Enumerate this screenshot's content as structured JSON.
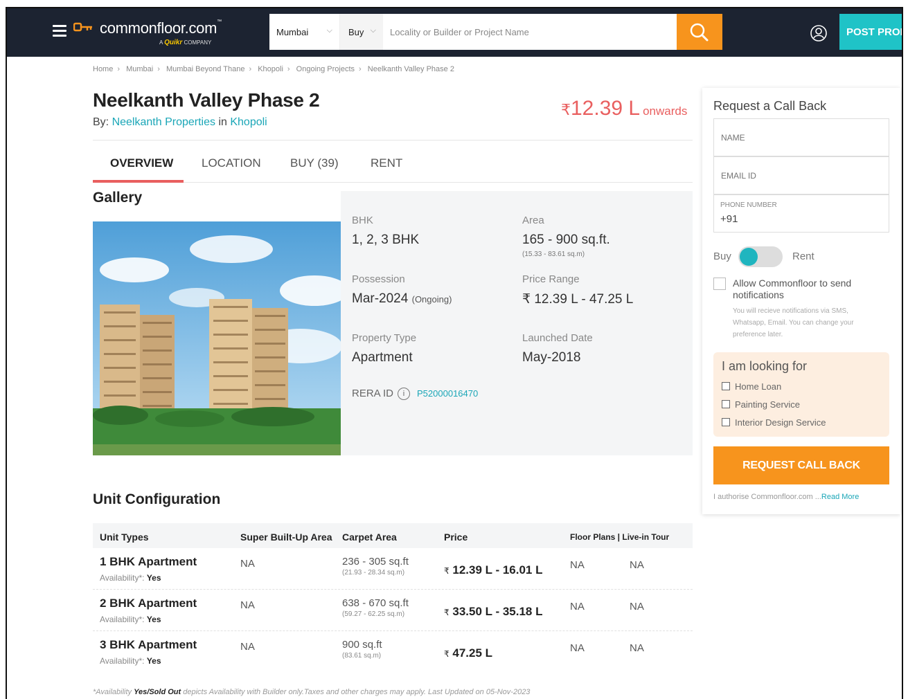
{
  "header": {
    "logo_text": "commonfloor.com",
    "logo_tm": "™",
    "logo_sub_a": "A",
    "logo_sub_quikr": "Quikr",
    "logo_sub_company": "COMPANY",
    "city": "Mumbai",
    "mode": "Buy",
    "search_placeholder": "Locality or Builder or Project Name",
    "post_label": "POST PROP"
  },
  "breadcrumb": [
    "Home",
    "Mumbai",
    "Mumbai Beyond Thane",
    "Khopoli",
    "Ongoing Projects",
    "Neelkanth Valley Phase 2"
  ],
  "project": {
    "title": "Neelkanth Valley Phase 2",
    "by_prefix": "By:",
    "builder": "Neelkanth Properties",
    "in_word": "in",
    "locality": "Khopoli",
    "price_symbol": "₹",
    "price": "12.39 L",
    "price_suffix": "onwards"
  },
  "tabs": [
    "OVERVIEW",
    "LOCATION",
    "BUY (39)",
    "RENT"
  ],
  "gallery_heading": "Gallery",
  "details": {
    "bhk_label": "BHK",
    "bhk_value": "1, 2, 3 BHK",
    "area_label": "Area",
    "area_value": "165 - 900 sq.ft.",
    "area_sub": "(15.33 - 83.61 sq.m)",
    "possession_label": "Possession",
    "possession_value": "Mar-2024",
    "possession_status": "(Ongoing)",
    "price_range_label": "Price Range",
    "price_range_value": "₹ 12.39 L - 47.25 L",
    "type_label": "Property Type",
    "type_value": "Apartment",
    "launched_label": "Launched Date",
    "launched_value": "May-2018",
    "rera_label": "RERA ID",
    "rera_info": "i",
    "rera_value": "P52000016470"
  },
  "unit_config": {
    "heading": "Unit Configuration",
    "headers": [
      "Unit Types",
      "Super Built-Up Area",
      "Carpet Area",
      "Price",
      "Floor Plans | Live-in Tour"
    ],
    "avail_label": "Availability*:",
    "rows": [
      {
        "type": "1 BHK Apartment",
        "availability": "Yes",
        "super_area": "NA",
        "carpet": "236 - 305 sq.ft",
        "carpet_sub": "(21.93 - 28.34 sq.m)",
        "price_symbol": "₹",
        "price": "12.39 L - 16.01 L",
        "floor_plan": "NA",
        "tour": "NA"
      },
      {
        "type": "2 BHK Apartment",
        "availability": "Yes",
        "super_area": "NA",
        "carpet": "638 - 670 sq.ft",
        "carpet_sub": "(59.27 - 62.25 sq.m)",
        "price_symbol": "₹",
        "price": "33.50 L - 35.18 L",
        "floor_plan": "NA",
        "tour": "NA"
      },
      {
        "type": "3 BHK Apartment",
        "availability": "Yes",
        "super_area": "NA",
        "carpet": "900 sq.ft",
        "carpet_sub": "(83.61 sq.m)",
        "price_symbol": "₹",
        "price": "47.25 L",
        "floor_plan": "NA",
        "tour": "NA"
      }
    ],
    "footnote_pre": "*Availability",
    "footnote_bold": "Yes/Sold Out",
    "footnote_post": "depicts Availability with Builder only.Taxes and other charges may apply. Last Updated on 05-Nov-2023"
  },
  "form": {
    "heading": "Request a Call Back",
    "name_placeholder": "NAME",
    "email_placeholder": "EMAIL ID",
    "phone_label": "PHONE NUMBER",
    "phone_prefix": "+91",
    "toggle_left": "Buy",
    "toggle_right": "Rent",
    "allow_text": "Allow Commonfloor to send notifications",
    "allow_sub": "You will recieve notifications via SMS, Whatsapp, Email. You can change your preference later.",
    "looking_heading": "I am looking for",
    "looking_options": [
      "Home Loan",
      "Painting Service",
      "Interior Design Service"
    ],
    "button_label": "REQUEST CALL BACK",
    "authorise_text": "I authorise Commonfloor.com ...",
    "read_more": "Read More"
  },
  "colors": {
    "header_bg": "#1c2331",
    "accent_orange": "#f7941d",
    "accent_teal": "#1fc3c7",
    "price_red": "#e95f5f"
  }
}
